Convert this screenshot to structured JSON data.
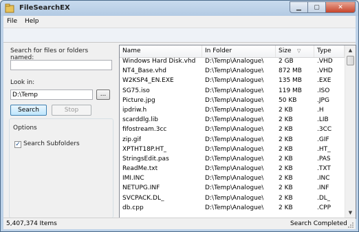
{
  "window": {
    "title": "FileSearchEX",
    "minimize": "▁",
    "maximize": "▢",
    "close": "✕"
  },
  "menu": [
    "File",
    "Help"
  ],
  "search": {
    "name_label": "Search for files or folders named:",
    "name_value": "",
    "lookin_label": "Look in:",
    "lookin_value": "D:\\Temp",
    "browse_label": "...",
    "search_label": "Search",
    "stop_label": "Stop"
  },
  "options": {
    "title": "Options",
    "subfolders_label": "Search Subfolders",
    "subfolders_checked": true
  },
  "list": {
    "columns": [
      "Name",
      "In Folder",
      "Size",
      "Type"
    ],
    "sort_indicator": "▽",
    "rows": [
      [
        "Windows Hard Disk.vhd",
        "D:\\Temp\\Analogue\\",
        "2 GB",
        ".VHD"
      ],
      [
        "NT4_Base.vhd",
        "D:\\Temp\\Analogue\\",
        "872 MB",
        ".VHD"
      ],
      [
        "W2KSP4_EN.EXE",
        "D:\\Temp\\Analogue\\",
        "135 MB",
        ".EXE"
      ],
      [
        "SG75.iso",
        "D:\\Temp\\Analogue\\",
        "119 MB",
        ".ISO"
      ],
      [
        "Picture.jpg",
        "D:\\Temp\\Analogue\\",
        "50 KB",
        ".JPG"
      ],
      [
        "ipdriw.h",
        "D:\\Temp\\Analogue\\",
        "2 KB",
        ".H"
      ],
      [
        "scarddlg.lib",
        "D:\\Temp\\Analogue\\",
        "2 KB",
        ".LIB"
      ],
      [
        "fifostream.3cc",
        "D:\\Temp\\Analogue\\",
        "2 KB",
        ".3CC"
      ],
      [
        "zip.gif",
        "D:\\Temp\\Analogue\\",
        "2 KB",
        ".GIF"
      ],
      [
        "XPTHT18P.HT_",
        "D:\\Temp\\Analogue\\",
        "2 KB",
        ".HT_"
      ],
      [
        "StringsEdit.pas",
        "D:\\Temp\\Analogue\\",
        "2 KB",
        ".PAS"
      ],
      [
        "ReadMe.txt",
        "D:\\Temp\\Analogue\\",
        "2 KB",
        ".TXT"
      ],
      [
        "IMI.INC",
        "D:\\Temp\\Analogue\\",
        "2 KB",
        ".INC"
      ],
      [
        "NETUPG.INF",
        "D:\\Temp\\Analogue\\",
        "2 KB",
        ".INF"
      ],
      [
        "SVCPACK.DL_",
        "D:\\Temp\\Analogue\\",
        "2 KB",
        ".DL_"
      ],
      [
        "db.cpp",
        "D:\\Temp\\Analogue\\",
        "2 KB",
        ".CPP"
      ]
    ],
    "scroll_up": "▲",
    "scroll_down": "▼"
  },
  "status": {
    "count": "5,407,374 Items",
    "message": "Search Completed"
  }
}
